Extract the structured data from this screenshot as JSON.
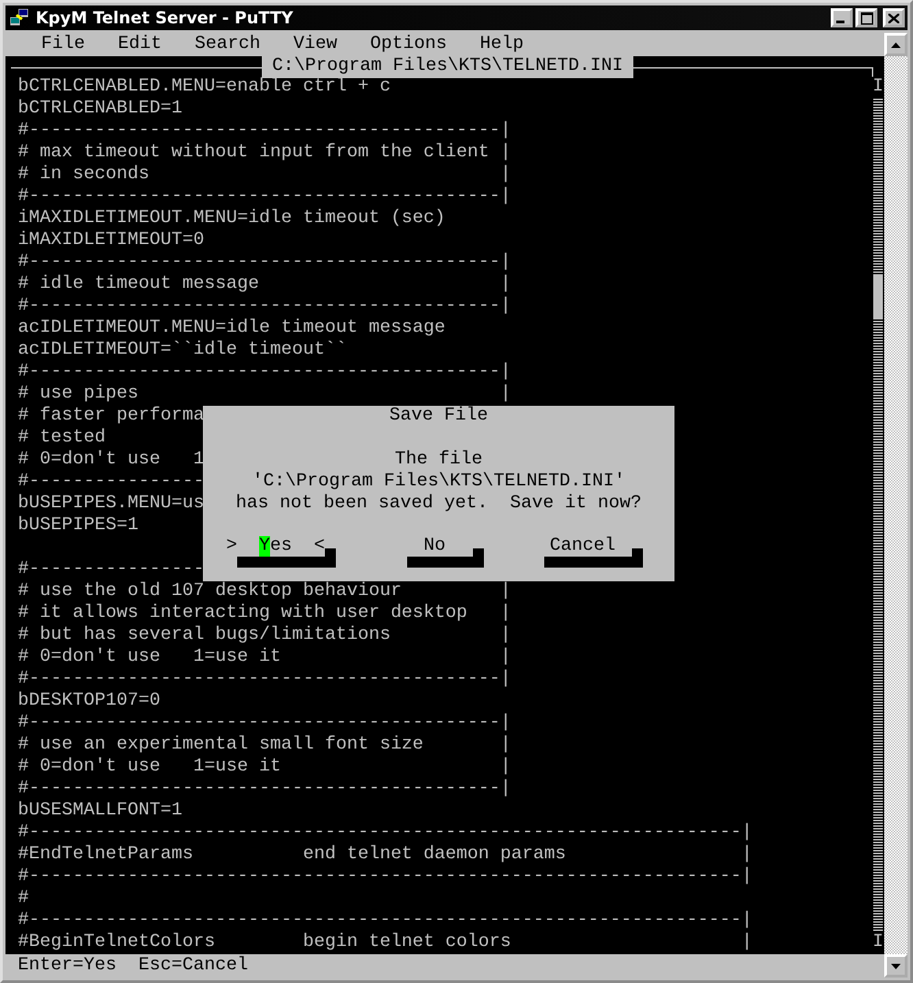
{
  "window": {
    "title": "KpyM Telnet Server - PuTTY"
  },
  "menu": [
    "File",
    "Edit",
    "Search",
    "View",
    "Options",
    "Help"
  ],
  "editor": {
    "file_path": "C:\\Program Files\\KTS\\TELNETD.INI",
    "scroll_marks": {
      "top": "I",
      "bottom": "I"
    },
    "blocks": [
      [
        "bCTRLCENABLED.MENU=enable ctrl + c",
        "bCTRLCENABLED=1",
        "#-------------------------------------------|",
        "# max timeout without input from the client |",
        "# in seconds                                |",
        "#-------------------------------------------|",
        "iMAXIDLETIMEOUT.MENU=idle timeout (sec)",
        "iMAXIDLETIMEOUT=0",
        "#-------------------------------------------|",
        "# idle timeout message                      |",
        "#-------------------------------------------|",
        "acIDLETIMEOUT.MENU=idle timeout message",
        "acIDLETIMEOUT=``idle timeout``",
        "#-------------------------------------------|",
        "# use pipes                                 |",
        "# faster performa",
        "# tested",
        "# 0=don't use   1",
        "#----------------",
        "bUSEPIPES.MENU=us",
        "bUSEPIPES=1"
      ],
      [
        "#----------------",
        "# use the old 107 desktop behaviour         |",
        "# it allows interacting with user desktop   |",
        "# but has several bugs/limitations          |",
        "# 0=don't use   1=use it                    |",
        "#-------------------------------------------|",
        "bDESKTOP107=0",
        "#-------------------------------------------|",
        "# use an experimental small font size       |",
        "# 0=don't use   1=use it                    |",
        "#-------------------------------------------|",
        "bUSESMALLFONT=1",
        "#-----------------------------------------------------------------|",
        "#EndTelnetParams          end telnet daemon params                |",
        "#-----------------------------------------------------------------|",
        "#",
        "#-----------------------------------------------------------------|",
        "#BeginTelnetColors        begin telnet colors                     |"
      ]
    ]
  },
  "dialog": {
    "title": "Save File",
    "message": [
      "The file",
      "'C:\\Program Files\\KTS\\TELNETD.INI'",
      "has not been saved yet.  Save it now?"
    ],
    "focus_marks": {
      "left": ">",
      "right": "<"
    },
    "buttons": [
      {
        "label": "Yes",
        "selected": true
      },
      {
        "label": "No",
        "selected": false
      },
      {
        "label": "Cancel",
        "selected": false
      }
    ]
  },
  "status_bar": "Enter=Yes  Esc=Cancel"
}
